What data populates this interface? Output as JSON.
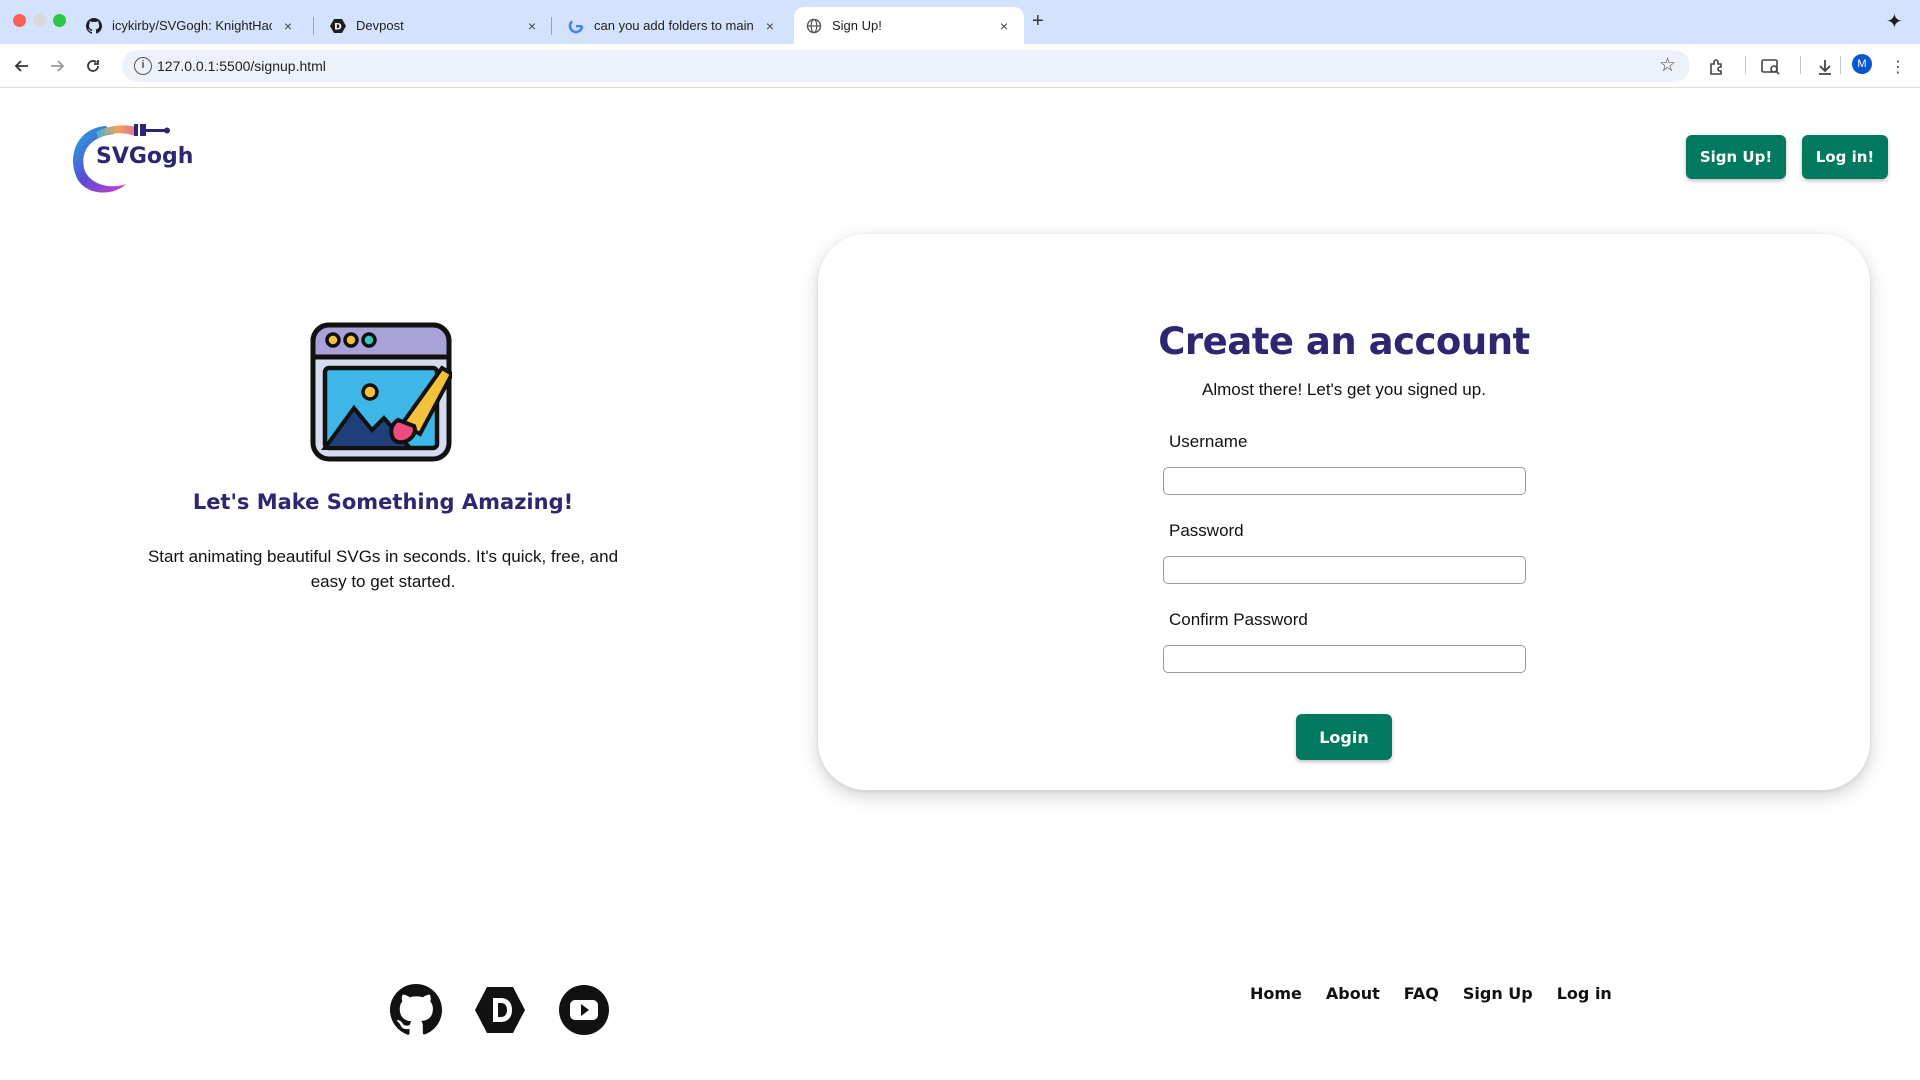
{
  "browser": {
    "tabs": [
      {
        "title": "icykirby/SVGogh: KnightHack",
        "icon": "github-icon",
        "close": "×"
      },
      {
        "title": "Devpost",
        "icon": "devpost-icon",
        "close": "×"
      },
      {
        "title": "can you add folders to main in",
        "icon": "google-icon",
        "close": "×"
      },
      {
        "title": "Sign Up!",
        "icon": "globe-icon",
        "close": "×"
      }
    ],
    "new_tab": "+",
    "url": "127.0.0.1:5500/signup.html",
    "avatar_letter": "M"
  },
  "header": {
    "logo_text": "SVGogh",
    "signup_label": "Sign Up!",
    "login_label": "Log in!"
  },
  "hero": {
    "icon": "image-edit-icon",
    "title": "Let's Make Something Amazing!",
    "subtitle": "Start animating beautiful SVGs in seconds. It's quick, free, and easy to get started."
  },
  "form": {
    "title": "Create an account",
    "subtitle": "Almost there! Let's get you signed up.",
    "fields": [
      {
        "label": "Username",
        "value": ""
      },
      {
        "label": "Password",
        "value": ""
      },
      {
        "label": "Confirm Password",
        "value": ""
      }
    ],
    "submit_label": "Login"
  },
  "footer": {
    "social": [
      "github-icon",
      "devpost-icon",
      "youtube-icon"
    ],
    "links": [
      "Home",
      "About",
      "FAQ",
      "Sign Up",
      "Log in"
    ]
  },
  "colors": {
    "primary_button": "#00795e",
    "heading": "#2d2670",
    "tabstrip": "#d3e3fd"
  }
}
